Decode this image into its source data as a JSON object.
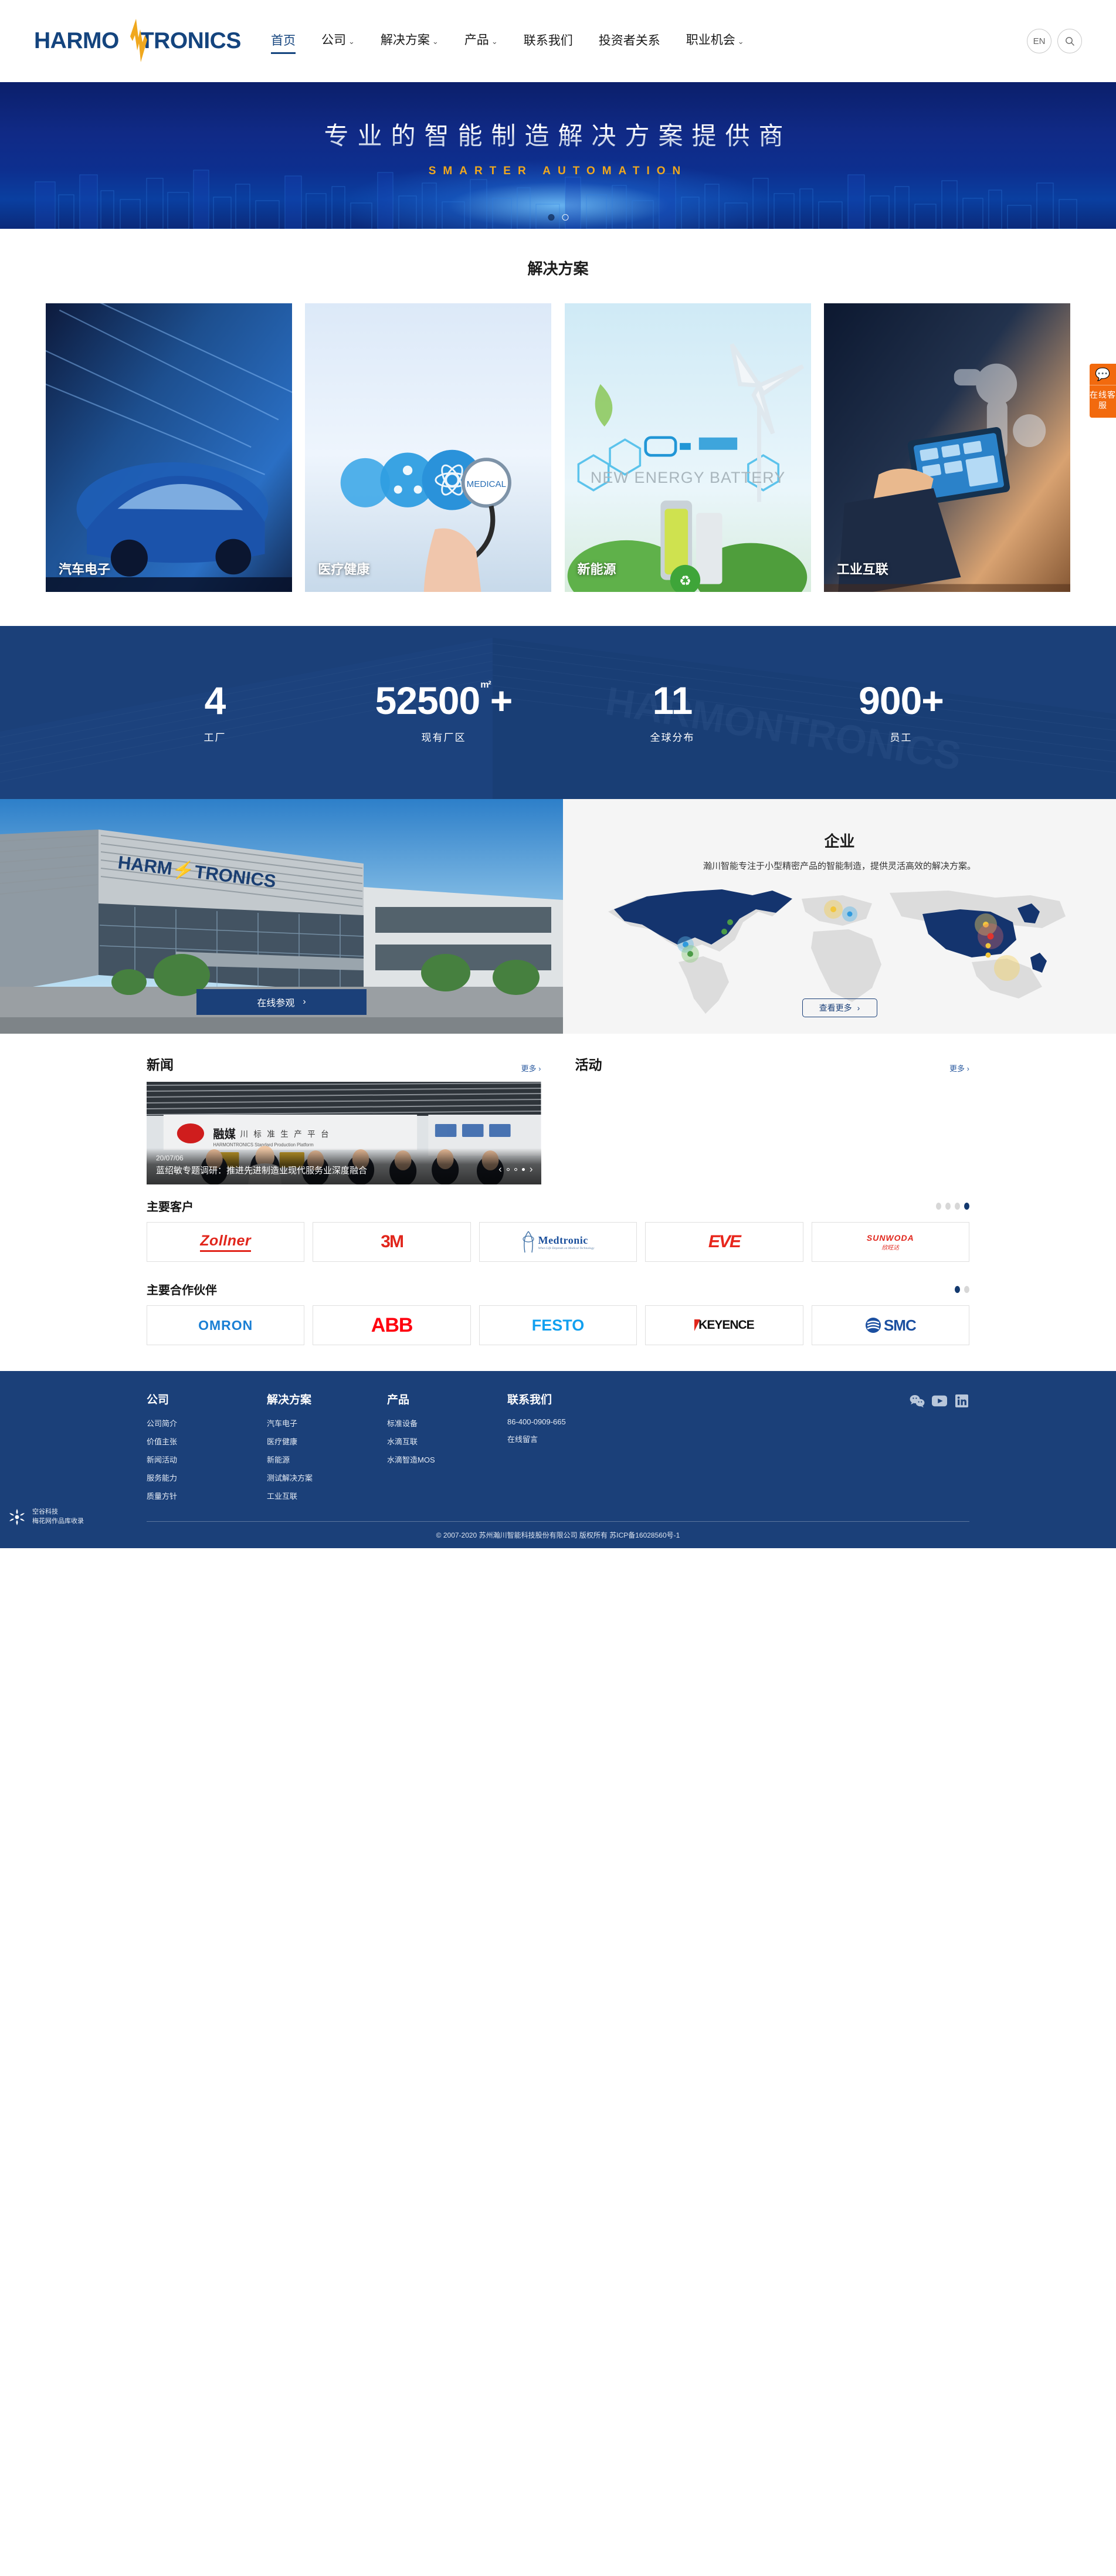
{
  "brand": {
    "name": "HARMONTRONICS",
    "logo_left": "HARMO",
    "logo_right": "TRONICS",
    "accent": "#14447e",
    "spark_color": "#f0a81e"
  },
  "header": {
    "nav": [
      {
        "label": "首页",
        "has_caret": false,
        "active": true
      },
      {
        "label": "公司",
        "has_caret": true,
        "active": false
      },
      {
        "label": "解决方案",
        "has_caret": true,
        "active": false
      },
      {
        "label": "产品",
        "has_caret": true,
        "active": false
      },
      {
        "label": "联系我们",
        "has_caret": false,
        "active": false
      },
      {
        "label": "投资者关系",
        "has_caret": false,
        "active": false
      },
      {
        "label": "职业机会",
        "has_caret": true,
        "active": false
      }
    ],
    "lang_button": "EN",
    "search_icon": "search-icon"
  },
  "hero": {
    "title": "专业的智能制造解决方案提供商",
    "subtitle": "SMARTER AUTOMATION",
    "dots": 2,
    "active_dot": 1,
    "bg_color": "#0d2a82"
  },
  "chat_widget": {
    "icon": "chat-bubble-icon",
    "label": "在线客服",
    "color": "#f26a0e"
  },
  "solutions": {
    "title": "解决方案",
    "cards": [
      {
        "label": "汽车电子",
        "theme": "automotive"
      },
      {
        "label": "医疗健康",
        "theme": "medical"
      },
      {
        "label": "新能源",
        "theme": "new-energy",
        "overlay_text": "NEW ENERGY BATTERY"
      },
      {
        "label": "工业互联",
        "theme": "industrial-iot"
      }
    ]
  },
  "stats": {
    "bg_color": "#1b4079",
    "items": [
      {
        "value": "4",
        "sup": "",
        "label": "工厂"
      },
      {
        "value": "52500",
        "sup": "m²",
        "suffix": "+",
        "label": "现有厂区"
      },
      {
        "value": "11",
        "sup": "",
        "label": "全球分布"
      },
      {
        "value": "900",
        "sup": "",
        "suffix": "+",
        "label": "员工"
      }
    ]
  },
  "enterprise": {
    "visit_button": "在线参观",
    "title": "企业",
    "description": "瀚川智能专注于小型精密产品的智能制造，提供灵活高效的解决方案。",
    "more_button": "查看更多",
    "map_regions": [
      "北美",
      "欧洲",
      "中国",
      "东南亚"
    ]
  },
  "news": {
    "columns": [
      {
        "heading": "新闻",
        "more": "更多",
        "card": {
          "date": "20/07/06",
          "title": "蓝绍敏专题调研：推进先进制造业现代服务业深度融合",
          "dots": 3,
          "active_dot": 2
        }
      },
      {
        "heading": "活动",
        "more": "更多",
        "card": null
      }
    ]
  },
  "customers": {
    "heading": "主要客户",
    "pages": 4,
    "active_page": 4,
    "logos": [
      {
        "name": "Zollner",
        "color": "#e1261c",
        "style": "italic-block"
      },
      {
        "name": "3M",
        "color": "#e1261c",
        "style": "heavy"
      },
      {
        "name": "Medtronic",
        "color": "#1a4f9c",
        "style": "serif",
        "tagline": "When Life Depends on Medical Technology"
      },
      {
        "name": "EVE",
        "color": "#e1261c",
        "style": "heavy-italic"
      },
      {
        "name": "SUNWODA",
        "color": "#e1261c",
        "style": "italic",
        "sub": "欣旺达"
      }
    ]
  },
  "partners": {
    "heading": "主要合作伙伴",
    "pages": 2,
    "active_page": 1,
    "logos": [
      {
        "name": "OMRON",
        "color": "#1a7fd4",
        "style": "rounded"
      },
      {
        "name": "ABB",
        "color": "#ff000f",
        "style": "heavy"
      },
      {
        "name": "FESTO",
        "color": "#11a0f0",
        "style": "heavy"
      },
      {
        "name": "KEYENCE",
        "color": "#111111",
        "style": "heavy",
        "mark_color": "#e1261c"
      },
      {
        "name": "SMC",
        "color": "#1b4fa0",
        "style": "heavy"
      }
    ]
  },
  "footer": {
    "bg_color": "#1b4079",
    "columns": [
      {
        "heading": "公司",
        "links": [
          "公司简介",
          "价值主张",
          "新闻活动",
          "服务能力",
          "质量方针"
        ]
      },
      {
        "heading": "解决方案",
        "links": [
          "汽车电子",
          "医疗健康",
          "新能源",
          "测试解决方案",
          "工业互联"
        ]
      },
      {
        "heading": "产品",
        "links": [
          "标准设备",
          "水滴互联",
          "水滴智造MOS"
        ]
      },
      {
        "heading": "联系我们",
        "links": [
          "86-400-0909-665",
          "在线留言"
        ]
      }
    ],
    "socials": [
      {
        "name": "wechat-icon",
        "label": "微信"
      },
      {
        "name": "youtube-icon",
        "label": "YouTube"
      },
      {
        "name": "linkedin-icon",
        "label": "LinkedIn"
      }
    ],
    "agency": {
      "line1": "空谷科技",
      "line2": "梅花网作品库收录",
      "icon": "snowflake-icon"
    },
    "copyright": "© 2007-2020 苏州瀚川智能科技股份有限公司 版权所有 苏ICP备16028560号-1"
  }
}
